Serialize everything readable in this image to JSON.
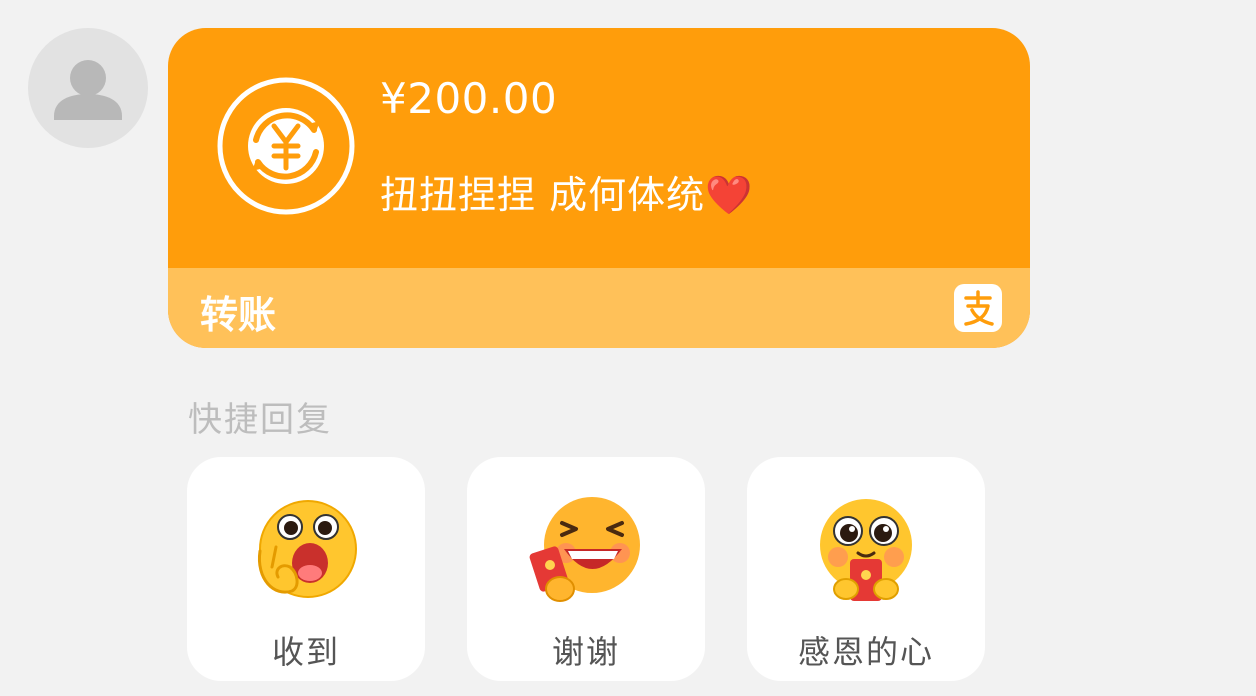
{
  "transfer": {
    "amount": "¥200.00",
    "message": "扭扭捏捏 成何体统❤️",
    "label": "转账",
    "icon": "yuan-exchange-icon",
    "payment_icon": "alipay-icon",
    "colors": {
      "card": "#ff9d0b",
      "footer": "#ffc159"
    }
  },
  "avatar": {
    "icon": "default-avatar-icon"
  },
  "quick_reply": {
    "title": "快捷回复",
    "options": [
      {
        "label": "收到",
        "icon": "ok-gesture-emoji"
      },
      {
        "label": "谢谢",
        "icon": "laughing-red-envelope-emoji"
      },
      {
        "label": "感恩的心",
        "icon": "grateful-red-envelope-emoji"
      }
    ]
  }
}
